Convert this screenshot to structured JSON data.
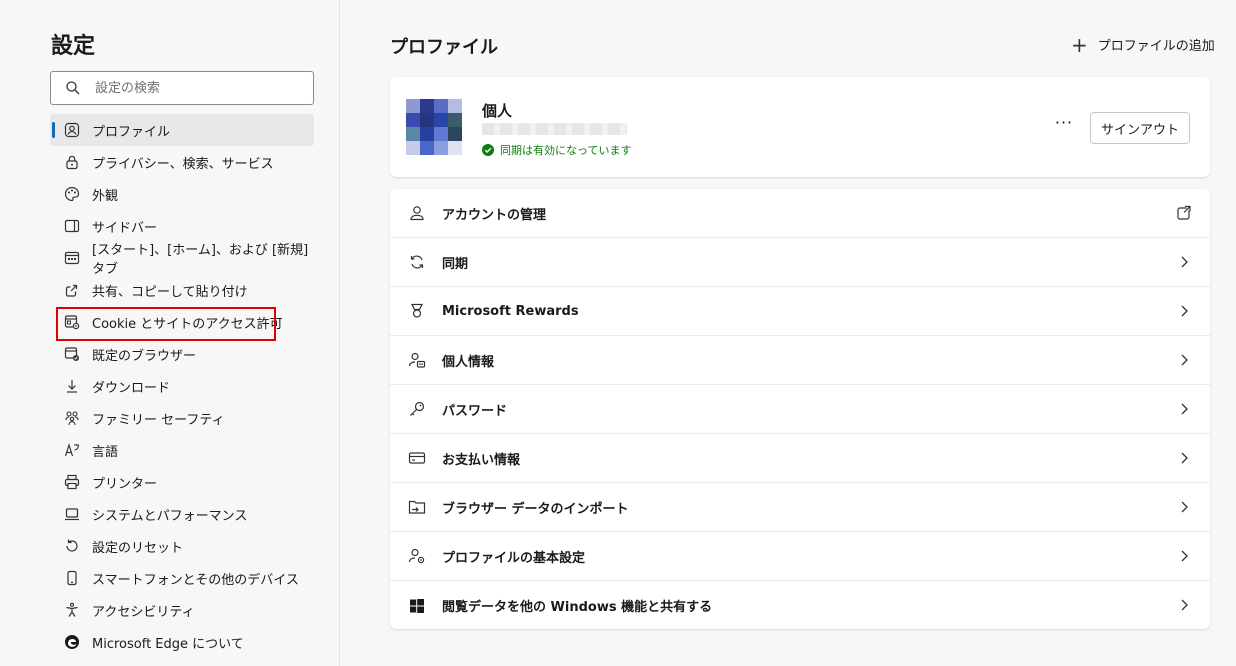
{
  "sidebar": {
    "title": "設定",
    "search_placeholder": "設定の検索",
    "items": [
      {
        "label": "プロファイル",
        "icon": "profile-icon"
      },
      {
        "label": "プライバシー、検索、サービス",
        "icon": "lock-icon"
      },
      {
        "label": "外観",
        "icon": "palette-icon"
      },
      {
        "label": "サイドバー",
        "icon": "sidebar-icon"
      },
      {
        "label": "[スタート]、[ホーム]、および [新規] タブ",
        "icon": "start-home-icon"
      },
      {
        "label": "共有、コピーして貼り付け",
        "icon": "share-icon"
      },
      {
        "label": "Cookie とサイトのアクセス許可",
        "icon": "cookie-permissions-icon"
      },
      {
        "label": "既定のブラウザー",
        "icon": "default-browser-icon"
      },
      {
        "label": "ダウンロード",
        "icon": "download-icon"
      },
      {
        "label": "ファミリー セーフティ",
        "icon": "family-icon"
      },
      {
        "label": "言語",
        "icon": "language-icon"
      },
      {
        "label": "プリンター",
        "icon": "printer-icon"
      },
      {
        "label": "システムとパフォーマンス",
        "icon": "laptop-icon"
      },
      {
        "label": "設定のリセット",
        "icon": "reset-icon"
      },
      {
        "label": "スマートフォンとその他のデバイス",
        "icon": "phone-icon"
      },
      {
        "label": "アクセシビリティ",
        "icon": "accessibility-icon"
      },
      {
        "label": "Microsoft Edge について",
        "icon": "edge-logo-icon"
      }
    ]
  },
  "main": {
    "title": "プロファイル",
    "add_profile_label": "プロファイルの追加",
    "profile": {
      "name": "個人",
      "sync_status": "同期は有効になっています",
      "more_label": "···",
      "signout_label": "サインアウト"
    },
    "rows": [
      {
        "label": "アカウントの管理",
        "icon": "account-icon",
        "action": "external-link-icon"
      },
      {
        "label": "同期",
        "icon": "sync-icon",
        "action": "chevron-right-icon"
      },
      {
        "label": "Microsoft Rewards",
        "icon": "rewards-icon",
        "action": "chevron-right-icon"
      },
      {
        "label": "個人情報",
        "icon": "personal-info-icon",
        "action": "chevron-right-icon"
      },
      {
        "label": "パスワード",
        "icon": "key-icon",
        "action": "chevron-right-icon"
      },
      {
        "label": "お支払い情報",
        "icon": "card-icon",
        "action": "chevron-right-icon"
      },
      {
        "label": "ブラウザー データのインポート",
        "icon": "import-icon",
        "action": "chevron-right-icon"
      },
      {
        "label": "プロファイルの基本設定",
        "icon": "profile-settings-icon",
        "action": "chevron-right-icon"
      },
      {
        "label": "閲覧データを他の Windows 機能と共有する",
        "icon": "windows-icon",
        "action": "chevron-right-icon"
      }
    ]
  },
  "colors": {
    "accent": "#0f6cbd",
    "highlight_box": "#e00000",
    "sync_green": "#107c10"
  }
}
